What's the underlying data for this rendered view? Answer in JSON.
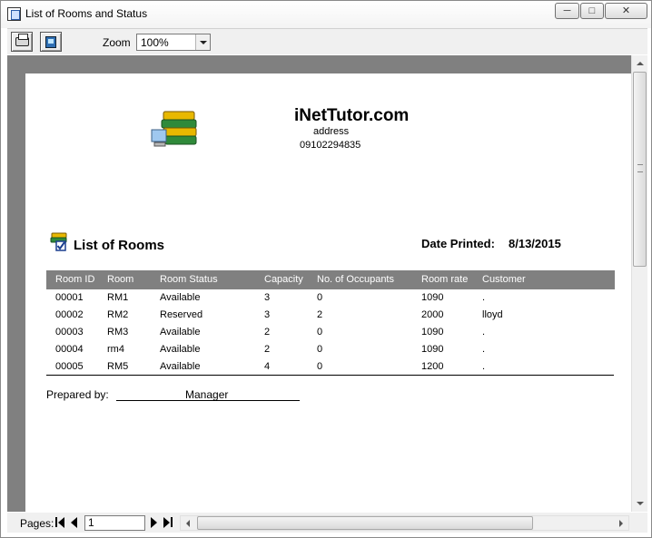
{
  "window": {
    "title": "List of Rooms and Status"
  },
  "toolbar": {
    "zoom_label": "Zoom",
    "zoom_value": "100%"
  },
  "report": {
    "company_name": "iNetTutor.com",
    "address": "address",
    "phone": "09102294835",
    "section_title": "List of Rooms",
    "date_label": "Date Printed:",
    "date_value": "8/13/2015",
    "columns": [
      "Room ID",
      "Room",
      "Room Status",
      "Capacity",
      "No. of Occupants",
      "Room rate",
      "Customer"
    ],
    "rows": [
      [
        "00001",
        "RM1",
        "Available",
        "3",
        "0",
        "1090",
        "."
      ],
      [
        "00002",
        "RM2",
        "Reserved",
        "3",
        "2",
        "2000",
        "lloyd"
      ],
      [
        "00003",
        "RM3",
        "Available",
        "2",
        "0",
        "1090",
        "."
      ],
      [
        "00004",
        "rm4",
        "Available",
        "2",
        "0",
        "1090",
        "."
      ],
      [
        "00005",
        "RM5",
        "Available",
        "4",
        "0",
        "1200",
        "."
      ]
    ],
    "prepared_by_label": "Prepared by:",
    "prepared_by_name": "Manager"
  },
  "navigation": {
    "pages_label": "Pages:",
    "current_page": "1"
  },
  "icons": {
    "app": "report-icon",
    "print": "printer-icon",
    "export": "export-icon",
    "logo": "books-computer-icon",
    "section": "books-checkmark-icon"
  },
  "colors": {
    "header_bar": "#808080",
    "viewer_background": "#808080"
  }
}
